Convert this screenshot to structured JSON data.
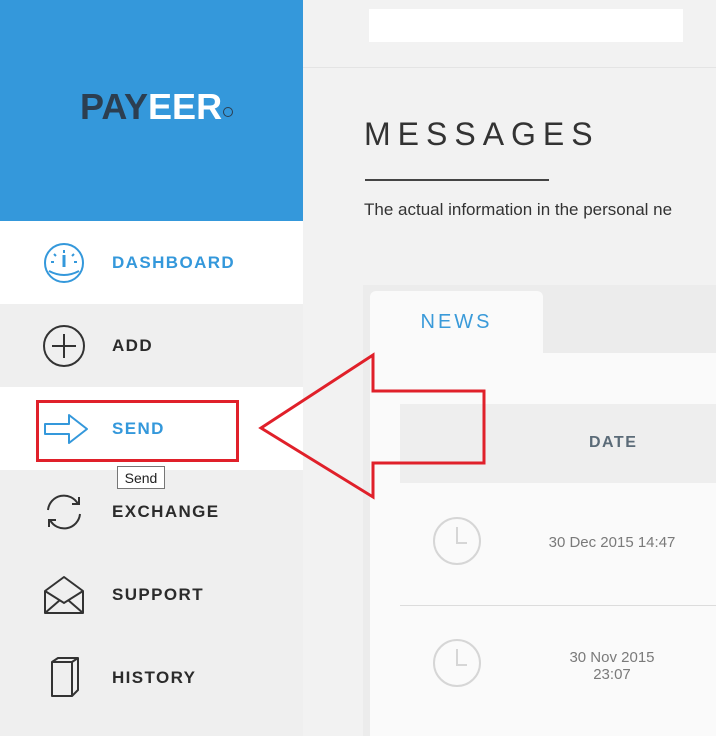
{
  "brand": {
    "logo_a": "PAY",
    "logo_b": "EER"
  },
  "sidebar": {
    "items": [
      {
        "label": "DASHBOARD",
        "icon": "dashboard-gauge-icon"
      },
      {
        "label": "ADD",
        "icon": "plus-circle-icon"
      },
      {
        "label": "SEND",
        "icon": "arrow-right-icon"
      },
      {
        "label": "EXCHANGE",
        "icon": "refresh-icon"
      },
      {
        "label": "SUPPORT",
        "icon": "envelope-icon"
      },
      {
        "label": "HISTORY",
        "icon": "book-icon"
      }
    ],
    "active": "DASHBOARD",
    "tooltip": "Send"
  },
  "main": {
    "title": "MESSAGES",
    "intro": "The actual information in the personal ne",
    "tabs": [
      {
        "label": "NEWS"
      }
    ],
    "table": {
      "columns": [
        "DATE"
      ],
      "rows": [
        {
          "date": "30 Dec 2015 14:47",
          "icon": "clock-icon"
        },
        {
          "date_line1": "30 Nov 2015",
          "date_line2": "23:07",
          "icon": "clock-icon"
        }
      ]
    }
  },
  "colors": {
    "brand_blue": "#3498db",
    "highlight_red": "#e0202a",
    "text_dark": "#2b2b2b"
  }
}
